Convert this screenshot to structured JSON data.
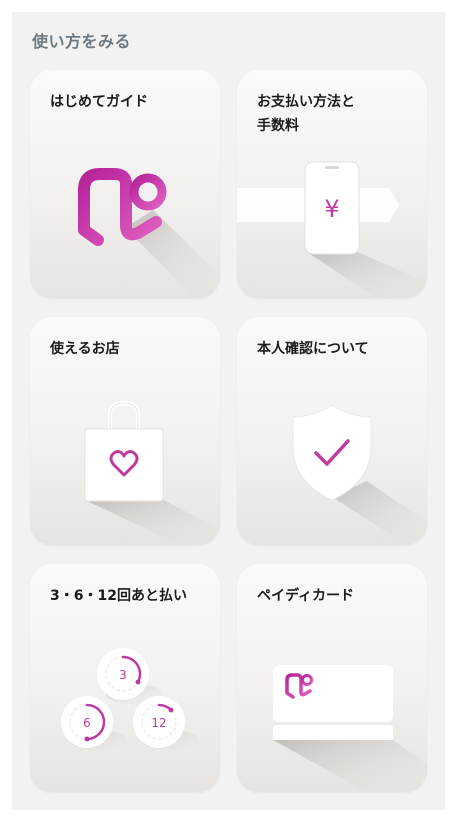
{
  "section": {
    "title": "使い方をみる"
  },
  "cards": [
    {
      "title": "はじめてガイド",
      "icon": "paidy-logo-icon"
    },
    {
      "title": "お支払い方法と\n手数料",
      "icon": "phone-yen-icon",
      "symbol": "¥"
    },
    {
      "title": "使えるお店",
      "icon": "shopping-bag-heart-icon"
    },
    {
      "title": "本人確認について",
      "icon": "shield-check-icon"
    },
    {
      "title": "3・6・12回あと払い",
      "icon": "installment-dials-icon",
      "dials": [
        "3",
        "6",
        "12"
      ]
    },
    {
      "title": "ペイディカード",
      "icon": "paidy-card-icon"
    }
  ],
  "colors": {
    "accent": "#c03aa0",
    "accent_dark": "#a52a85",
    "accent_light": "#e06cc2"
  }
}
